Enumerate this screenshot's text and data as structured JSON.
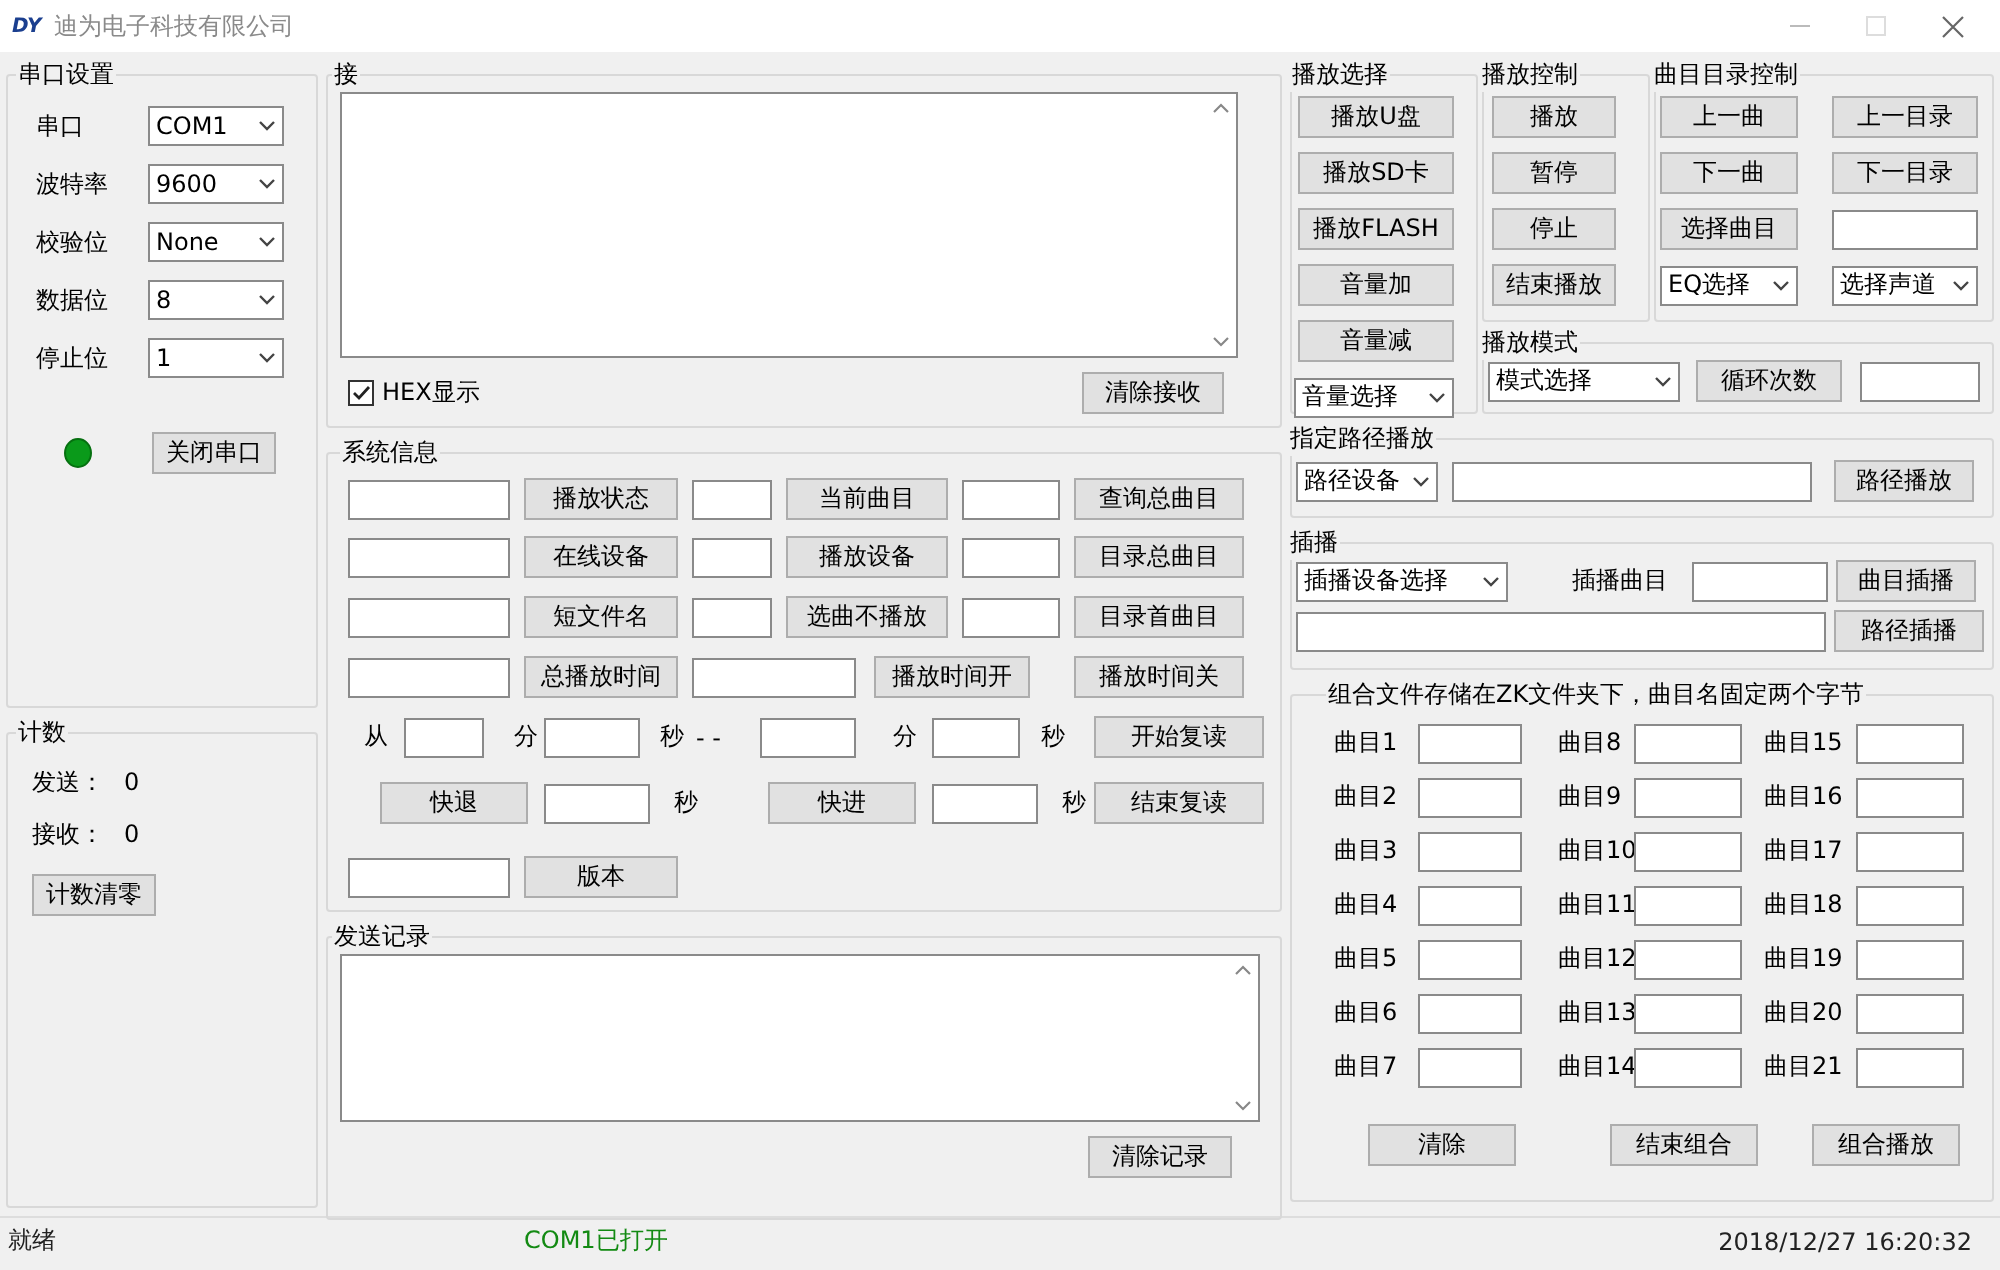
{
  "window": {
    "logo": "DY",
    "title": "迪为电子科技有限公司"
  },
  "serial_settings": {
    "title": "串口设置",
    "rows": [
      [
        {
          "kind": "label",
          "text": "串口"
        },
        {
          "kind": "select",
          "value": "COM1"
        }
      ],
      [
        {
          "kind": "label",
          "text": "波特率"
        },
        {
          "kind": "select",
          "value": "9600"
        }
      ],
      [
        {
          "kind": "label",
          "text": "校验位"
        },
        {
          "kind": "select",
          "value": "None"
        }
      ],
      [
        {
          "kind": "label",
          "text": "数据位"
        },
        {
          "kind": "select",
          "value": "8"
        }
      ],
      [
        {
          "kind": "label",
          "text": "停止位"
        },
        {
          "kind": "select",
          "value": "1"
        }
      ],
      [
        {
          "kind": "led",
          "on": true
        },
        {
          "kind": "button",
          "label": "关闭串口"
        }
      ]
    ]
  },
  "counter": {
    "title": "计数",
    "rows": [
      [
        {
          "kind": "label",
          "text": "发送："
        },
        {
          "kind": "label",
          "text": "0"
        }
      ],
      [
        {
          "kind": "label",
          "text": "接收："
        },
        {
          "kind": "label",
          "text": "0"
        }
      ],
      [
        {
          "kind": "button",
          "label": "计数清零"
        }
      ]
    ]
  },
  "receive": {
    "title": "接",
    "rows": [
      [
        {
          "kind": "textarea"
        }
      ],
      [
        {
          "kind": "check",
          "label": "HEX显示",
          "checked": true
        },
        {
          "kind": "button",
          "label": "清除接收"
        }
      ]
    ]
  },
  "system_info": {
    "title": "系统信息",
    "rows": [
      [
        {
          "kind": "field"
        },
        {
          "kind": "button",
          "label": "播放状态"
        },
        {
          "kind": "field"
        },
        {
          "kind": "button",
          "label": "当前曲目"
        },
        {
          "kind": "field"
        },
        {
          "kind": "button",
          "label": "查询总曲目"
        }
      ],
      [
        {
          "kind": "field"
        },
        {
          "kind": "button",
          "label": "在线设备"
        },
        {
          "kind": "field"
        },
        {
          "kind": "button",
          "label": "播放设备"
        },
        {
          "kind": "field"
        },
        {
          "kind": "button",
          "label": "目录总曲目"
        }
      ],
      [
        {
          "kind": "field"
        },
        {
          "kind": "button",
          "label": "短文件名"
        },
        {
          "kind": "field"
        },
        {
          "kind": "button",
          "label": "选曲不播放"
        },
        {
          "kind": "field"
        },
        {
          "kind": "button",
          "label": "目录首曲目"
        }
      ],
      [
        {
          "kind": "field"
        },
        {
          "kind": "button",
          "label": "总播放时间"
        },
        {
          "kind": "field"
        },
        {
          "kind": "button",
          "label": "播放时间开"
        },
        "",
        {
          "kind": "button",
          "label": "播放时间关"
        }
      ],
      [
        {
          "kind": "label",
          "text": "从"
        },
        {
          "kind": "field"
        },
        {
          "kind": "label",
          "text": "分"
        },
        {
          "kind": "field"
        },
        {
          "kind": "label",
          "text": "秒"
        },
        {
          "kind": "label",
          "text": "- -"
        },
        {
          "kind": "field"
        },
        {
          "kind": "label",
          "text": "分"
        },
        {
          "kind": "field"
        },
        {
          "kind": "label",
          "text": "秒"
        },
        {
          "kind": "button",
          "label": "开始复读"
        }
      ],
      [
        {
          "kind": "button",
          "label": "快退"
        },
        {
          "kind": "field"
        },
        {
          "kind": "label",
          "text": "秒"
        },
        {
          "kind": "button",
          "label": "快进"
        },
        {
          "kind": "field"
        },
        {
          "kind": "label",
          "text": "秒"
        },
        {
          "kind": "button",
          "label": "结束复读"
        }
      ],
      [
        {
          "kind": "field"
        },
        {
          "kind": "button",
          "label": "版本"
        }
      ]
    ]
  },
  "send_record": {
    "title": "发送记录",
    "rows": [
      [
        {
          "kind": "textarea"
        }
      ],
      [
        {
          "kind": "button",
          "label": "清除记录"
        }
      ]
    ]
  },
  "play_select": {
    "title": "播放选择",
    "rows": [
      [
        {
          "kind": "button",
          "label": "播放U盘"
        }
      ],
      [
        {
          "kind": "button",
          "label": "播放SD卡"
        }
      ],
      [
        {
          "kind": "button",
          "label": "播放FLASH"
        }
      ],
      [
        {
          "kind": "button",
          "label": "音量加"
        }
      ],
      [
        {
          "kind": "button",
          "label": "音量减"
        }
      ],
      [
        {
          "kind": "select",
          "value": "音量选择"
        }
      ]
    ]
  },
  "play_control": {
    "title": "播放控制",
    "rows": [
      [
        {
          "kind": "button",
          "label": "播放"
        }
      ],
      [
        {
          "kind": "button",
          "label": "暂停"
        }
      ],
      [
        {
          "kind": "button",
          "label": "停止"
        }
      ],
      [
        {
          "kind": "button",
          "label": "结束播放"
        }
      ]
    ]
  },
  "directory_control": {
    "title": "曲目目录控制",
    "rows": [
      [
        {
          "kind": "button",
          "label": "上一曲"
        },
        {
          "kind": "button",
          "label": "上一目录"
        }
      ],
      [
        {
          "kind": "button",
          "label": "下一曲"
        },
        {
          "kind": "button",
          "label": "下一目录"
        }
      ],
      [
        {
          "kind": "button",
          "label": "选择曲目"
        },
        {
          "kind": "field"
        }
      ],
      [
        {
          "kind": "select",
          "value": "EQ选择"
        },
        {
          "kind": "select",
          "value": "选择声道"
        }
      ]
    ]
  },
  "play_mode": {
    "title": "播放模式",
    "rows": [
      [
        {
          "kind": "select",
          "value": "模式选择"
        },
        {
          "kind": "button",
          "label": "循环次数"
        },
        {
          "kind": "field"
        }
      ]
    ]
  },
  "path_play": {
    "title": "指定路径播放",
    "rows": [
      [
        {
          "kind": "select",
          "value": "路径设备"
        },
        {
          "kind": "field"
        },
        {
          "kind": "button",
          "label": "路径播放"
        }
      ]
    ]
  },
  "insert_play": {
    "title": "插播",
    "rows": [
      [
        {
          "kind": "select",
          "value": "插播设备选择"
        },
        {
          "kind": "label",
          "text": "插播曲目"
        },
        {
          "kind": "field"
        },
        {
          "kind": "button",
          "label": "曲目插播"
        }
      ],
      [
        {
          "kind": "field"
        },
        "",
        "",
        {
          "kind": "button",
          "label": "路径插播"
        }
      ]
    ]
  },
  "combination": {
    "title": "组合文件存储在ZK文件夹下，曲目名固定两个字节",
    "rows": [
      [
        {
          "kind": "label",
          "text": "曲目1"
        },
        {
          "kind": "field"
        },
        {
          "kind": "label",
          "text": "曲目8"
        },
        {
          "kind": "field"
        },
        {
          "kind": "label",
          "text": "曲目15"
        },
        {
          "kind": "field"
        }
      ],
      [
        {
          "kind": "label",
          "text": "曲目2"
        },
        {
          "kind": "field"
        },
        {
          "kind": "label",
          "text": "曲目9"
        },
        {
          "kind": "field"
        },
        {
          "kind": "label",
          "text": "曲目16"
        },
        {
          "kind": "field"
        }
      ],
      [
        {
          "kind": "label",
          "text": "曲目3"
        },
        {
          "kind": "field"
        },
        {
          "kind": "label",
          "text": "曲目10"
        },
        {
          "kind": "field"
        },
        {
          "kind": "label",
          "text": "曲目17"
        },
        {
          "kind": "field"
        }
      ],
      [
        {
          "kind": "label",
          "text": "曲目4"
        },
        {
          "kind": "field"
        },
        {
          "kind": "label",
          "text": "曲目11"
        },
        {
          "kind": "field"
        },
        {
          "kind": "label",
          "text": "曲目18"
        },
        {
          "kind": "field"
        }
      ],
      [
        {
          "kind": "label",
          "text": "曲目5"
        },
        {
          "kind": "field"
        },
        {
          "kind": "label",
          "text": "曲目12"
        },
        {
          "kind": "field"
        },
        {
          "kind": "label",
          "text": "曲目19"
        },
        {
          "kind": "field"
        }
      ],
      [
        {
          "kind": "label",
          "text": "曲目6"
        },
        {
          "kind": "field"
        },
        {
          "kind": "label",
          "text": "曲目13"
        },
        {
          "kind": "field"
        },
        {
          "kind": "label",
          "text": "曲目20"
        },
        {
          "kind": "field"
        }
      ],
      [
        {
          "kind": "label",
          "text": "曲目7"
        },
        {
          "kind": "field"
        },
        {
          "kind": "label",
          "text": "曲目14"
        },
        {
          "kind": "field"
        },
        {
          "kind": "label",
          "text": "曲目21"
        },
        {
          "kind": "field"
        }
      ],
      [
        {
          "kind": "button",
          "label": "清除"
        },
        {
          "kind": "button",
          "label": "结束组合"
        },
        {
          "kind": "button",
          "label": "组合播放"
        }
      ]
    ]
  },
  "status_bar": {
    "panes": [
      {
        "text": "就绪",
        "kind": "plain"
      },
      {
        "text": "COM1已打开",
        "kind": "ok"
      },
      {
        "text": "2018/12/27 16:20:32",
        "kind": "plain"
      }
    ]
  }
}
